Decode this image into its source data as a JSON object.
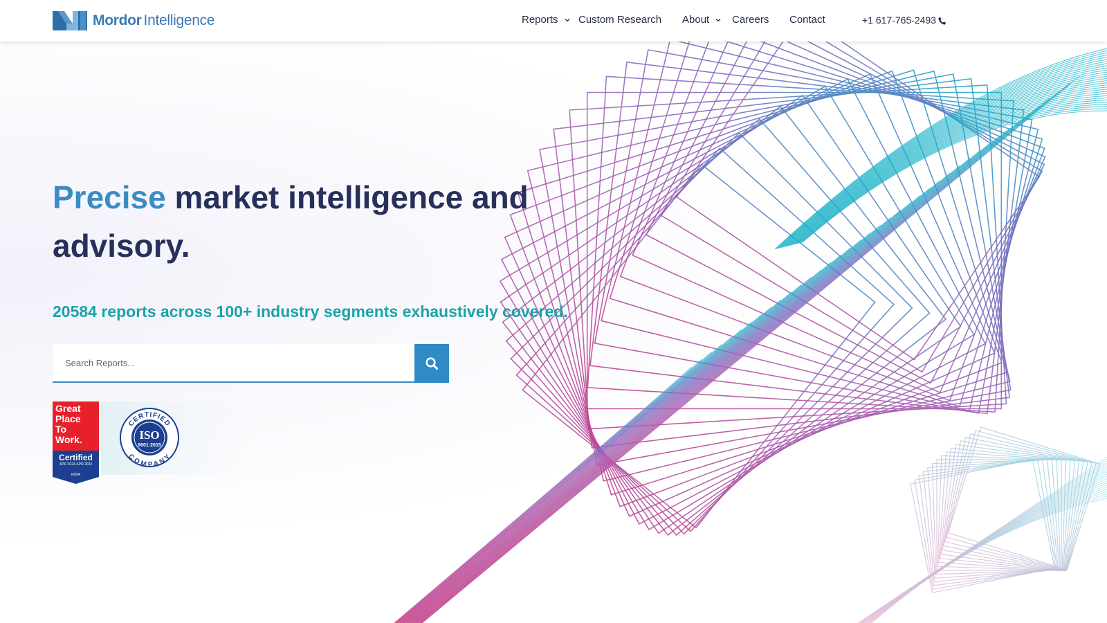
{
  "header": {
    "logo": {
      "word1": "Mordor",
      "word2": "Intelligence"
    },
    "nav": [
      {
        "label": "Reports",
        "has_dropdown": true
      },
      {
        "label": "Custom Research",
        "has_dropdown": false
      },
      {
        "label": "About",
        "has_dropdown": true
      },
      {
        "label": "Careers",
        "has_dropdown": false
      },
      {
        "label": "Contact",
        "has_dropdown": false
      }
    ],
    "phone": "+1 617-765-2493",
    "phone_icon": "phone-icon",
    "dropdown_icon": "chevron-down-icon"
  },
  "hero": {
    "title_accent": "Precise",
    "title_rest": "market intelligence and advisory.",
    "subtitle": "20584 reports across 100+ industry segments exhaustively covered.",
    "search": {
      "placeholder": "Search Reports...",
      "value": "",
      "button_icon": "search-icon"
    }
  },
  "badges": {
    "gptw": {
      "lines": [
        "Great",
        "Place",
        "To",
        "Work."
      ],
      "certified": "Certified",
      "dates": "APR 2023-APR 2024",
      "country": "INDIA"
    },
    "iso": {
      "top_text": "CERTIFIED",
      "mark": "ISO",
      "standard": "9001:2015",
      "bottom_text": "COMPANY"
    }
  },
  "colors": {
    "brand_blue": "#3a79b7",
    "title_navy": "#26305a",
    "accent_blue": "#3a8cc4",
    "subtitle_teal": "#1aa3a8",
    "search_button": "#2f8ac6",
    "gptw_red": "#e8202a",
    "gptw_blue": "#1c3f8f",
    "iso_blue": "#1c3f8f",
    "art_teal": "#19b2c8",
    "art_purple": "#7b6fc0",
    "art_magenta": "#c4408a"
  }
}
